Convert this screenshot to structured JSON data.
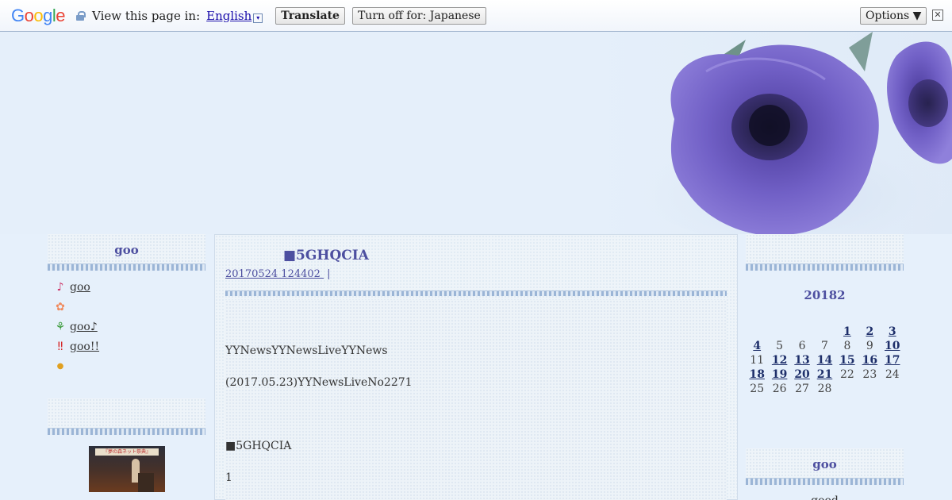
{
  "translate_bar": {
    "logo_parts": [
      "G",
      "o",
      "o",
      "g",
      "l",
      "e"
    ],
    "view_text": "View this page in:",
    "language": "English",
    "dropdown_glyph": "▾",
    "translate_label": "Translate",
    "turn_off_label": "Turn off for: Japanese",
    "options_label": "Options ▼",
    "close_glyph": "✕"
  },
  "left": {
    "box1_title": "goo",
    "menu": [
      {
        "icon": "♪",
        "label": "goo",
        "color": "#cc3366"
      },
      {
        "icon": "✿",
        "label": "",
        "color": "#f08a5d"
      },
      {
        "icon": "⚘",
        "label": "goo♪ ",
        "color": "#3a9a3a"
      },
      {
        "icon": "‼",
        "label": "goo!! ",
        "color": "#d42020"
      },
      {
        "icon": "●",
        "label": "    ",
        "color": "#e0a020"
      }
    ],
    "box2_title": "",
    "thumb_caption": "『夢の森ネット祭典』"
  },
  "post": {
    "title": "■5GHQCIA",
    "date": "20170524 124402 ",
    "separator": "|",
    "link2": "  ",
    "lines": [
      "YYNewsYYNewsLiveYYNews",
      "(2017.05.23)YYNewsLiveNo2271",
      "■5GHQCIA",
      "1"
    ]
  },
  "right": {
    "box1_title": "",
    "calendar_title": "20182",
    "calendar_rows": [
      [
        {
          "d": ""
        },
        {
          "d": ""
        },
        {
          "d": ""
        },
        {
          "d": ""
        },
        {
          "d": "1",
          "l": true
        },
        {
          "d": "2",
          "l": true
        },
        {
          "d": "3",
          "l": true
        }
      ],
      [
        {
          "d": "4",
          "l": true
        },
        {
          "d": "5"
        },
        {
          "d": "6"
        },
        {
          "d": "7"
        },
        {
          "d": "8"
        },
        {
          "d": "9"
        },
        {
          "d": "10",
          "l": true
        }
      ],
      [
        {
          "d": "11"
        },
        {
          "d": "12",
          "l": true
        },
        {
          "d": "13",
          "l": true
        },
        {
          "d": "14",
          "l": true
        },
        {
          "d": "15",
          "l": true
        },
        {
          "d": "16",
          "l": true
        },
        {
          "d": "17",
          "l": true
        }
      ],
      [
        {
          "d": "18",
          "l": true
        },
        {
          "d": "19",
          "l": true
        },
        {
          "d": "20",
          "l": true
        },
        {
          "d": "21",
          "l": true
        },
        {
          "d": "22"
        },
        {
          "d": "23"
        },
        {
          "d": "24"
        }
      ],
      [
        {
          "d": "25"
        },
        {
          "d": "26"
        },
        {
          "d": "27"
        },
        {
          "d": "28"
        },
        {
          "d": ""
        },
        {
          "d": ""
        },
        {
          "d": ""
        }
      ]
    ],
    "box2_title": "goo",
    "good_text": "good"
  }
}
